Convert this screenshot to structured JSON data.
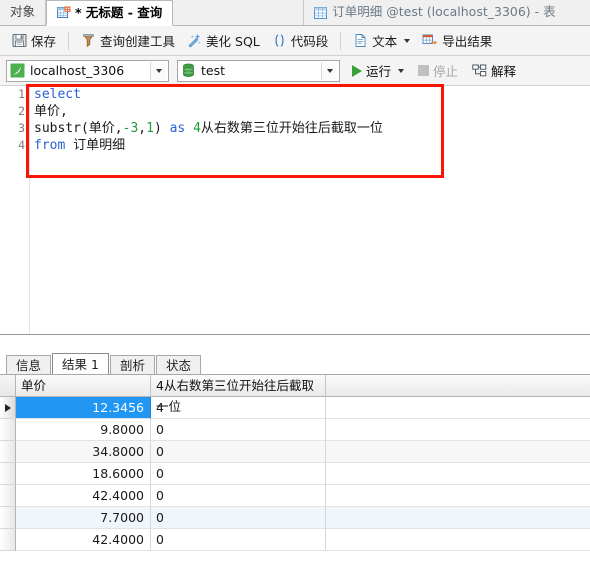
{
  "window": {
    "tabs": [
      {
        "label": "对象",
        "icon": "none",
        "state": "inactive"
      },
      {
        "label": "* 无标题 - 查询",
        "icon": "query-icon",
        "state": "active"
      },
      {
        "label": "订单明细 @test (localhost_3306) - 表",
        "icon": "table-icon",
        "state": "inactive"
      }
    ]
  },
  "toolbar": {
    "save_label": "保存",
    "query_builder_label": "查询创建工具",
    "beautify_label": "美化 SQL",
    "snippet_label": "代码段",
    "text_label": "文本",
    "export_label": "导出结果",
    "icons": {
      "save": "save-icon",
      "query_builder": "query-builder-icon",
      "beautify": "wand-icon",
      "snippet": "parentheses-icon",
      "text": "document-icon",
      "text_caret": "chevron-down-icon",
      "export": "export-icon"
    }
  },
  "connection_bar": {
    "connection_value": "localhost_3306",
    "database_value": "test",
    "run_label": "运行",
    "stop_label": "停止",
    "explain_label": "解释",
    "icons": {
      "connection": "mysql-leaf-icon",
      "database": "database-icon",
      "run": "play-icon",
      "run_caret": "chevron-down-icon",
      "stop": "stop-icon",
      "explain": "explain-icon",
      "combo_caret": "chevron-down-icon"
    }
  },
  "editor": {
    "line_numbers": [
      "1",
      "2",
      "3",
      "4"
    ],
    "lines": [
      {
        "tokens": [
          {
            "t": "select",
            "c": "kw"
          }
        ]
      },
      {
        "tokens": [
          {
            "t": "单价,",
            "c": "txt"
          }
        ]
      },
      {
        "tokens": [
          {
            "t": "substr(单价,",
            "c": "txt"
          },
          {
            "t": "-3",
            "c": "num"
          },
          {
            "t": ",",
            "c": "txt"
          },
          {
            "t": "1",
            "c": "num"
          },
          {
            "t": ") ",
            "c": "txt"
          },
          {
            "t": "as",
            "c": "kw"
          },
          {
            "t": " ",
            "c": "txt"
          },
          {
            "t": "4",
            "c": "num"
          },
          {
            "t": "从右数第三位开始往后截取一位",
            "c": "txt"
          }
        ]
      },
      {
        "tokens": [
          {
            "t": "from",
            "c": "kw"
          },
          {
            "t": " 订单明细",
            "c": "txt"
          }
        ]
      }
    ],
    "full_sql": "select\n单价,\nsubstr(单价,-3,1) as 4从右数第三位开始往后截取一位\nfrom 订单明细"
  },
  "result_tabs": [
    {
      "label": "信息",
      "active": false
    },
    {
      "label": "结果 1",
      "active": true
    },
    {
      "label": "剖析",
      "active": false
    },
    {
      "label": "状态",
      "active": false
    }
  ],
  "grid": {
    "columns": [
      "单价",
      "4从右数第三位开始往后截取一位"
    ],
    "rows": [
      {
        "cells": [
          "12.3456",
          "4"
        ],
        "selected": true,
        "tint": "none"
      },
      {
        "cells": [
          "9.8000",
          "0"
        ],
        "selected": false,
        "tint": "none"
      },
      {
        "cells": [
          "34.8000",
          "0"
        ],
        "selected": false,
        "tint": "alt"
      },
      {
        "cells": [
          "18.6000",
          "0"
        ],
        "selected": false,
        "tint": "none"
      },
      {
        "cells": [
          "42.4000",
          "0"
        ],
        "selected": false,
        "tint": "none"
      },
      {
        "cells": [
          "7.7000",
          "0"
        ],
        "selected": false,
        "tint": "tint"
      },
      {
        "cells": [
          "42.4000",
          "0"
        ],
        "selected": false,
        "tint": "none"
      }
    ]
  },
  "annotations": {
    "accent_color": "#fa1405",
    "boxes": [
      "sql-editor-highlight",
      "result-header-highlight"
    ]
  }
}
